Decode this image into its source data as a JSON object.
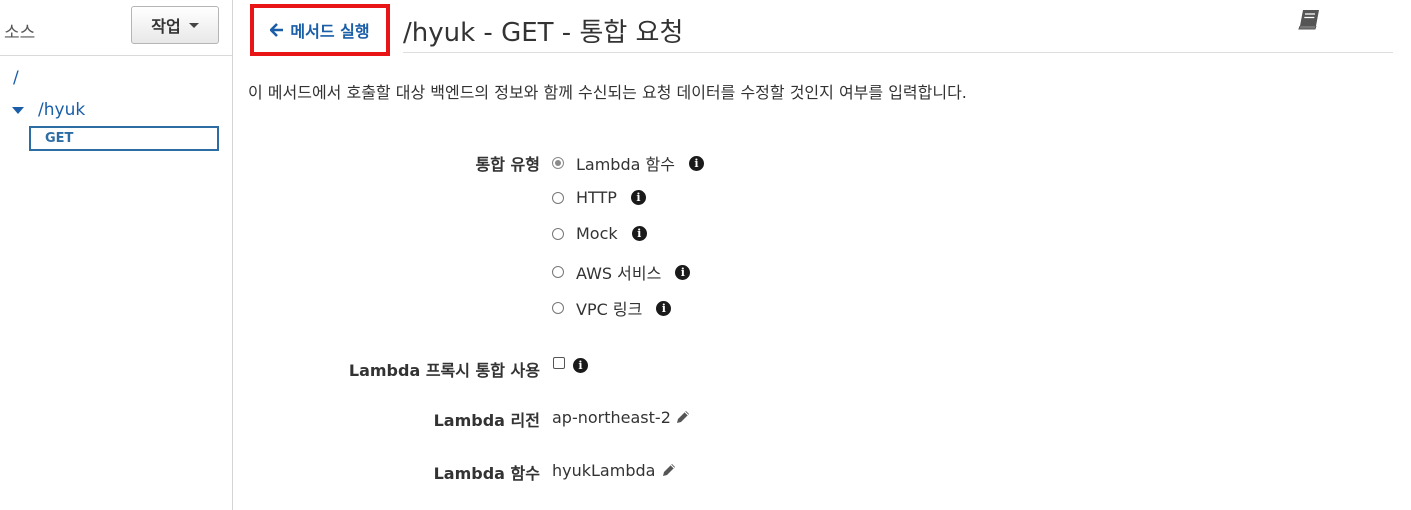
{
  "sidebar": {
    "title": "소스",
    "actions_label": "작업",
    "tree": {
      "root": "/",
      "resource": "/hyuk",
      "method": "GET"
    }
  },
  "header": {
    "back_label": "메서드 실행",
    "title": "/hyuk - GET - 통합 요청"
  },
  "description": "이 메서드에서 호출할 대상 백엔드의 정보와 함께 수신되는 요청 데이터를 수정할 것인지 여부를 입력합니다.",
  "form": {
    "integration_type_label": "통합 유형",
    "integration_types": [
      {
        "label": "Lambda 함수",
        "selected": true
      },
      {
        "label": "HTTP",
        "selected": false
      },
      {
        "label": "Mock",
        "selected": false
      },
      {
        "label": "AWS 서비스",
        "selected": false
      },
      {
        "label": "VPC 링크",
        "selected": false
      }
    ],
    "proxy_label": "Lambda 프록시 통합 사용",
    "proxy_checked": false,
    "region_label": "Lambda 리전",
    "region_value": "ap-northeast-2",
    "function_label": "Lambda 함수",
    "function_value": "hyukLambda"
  },
  "icons": {
    "back": "arrow-left-icon",
    "book": "book-icon",
    "info": "info-icon",
    "edit": "pencil-icon"
  },
  "colors": {
    "link": "#1a5ea8",
    "highlight_border": "#e81416",
    "text": "#333333"
  }
}
